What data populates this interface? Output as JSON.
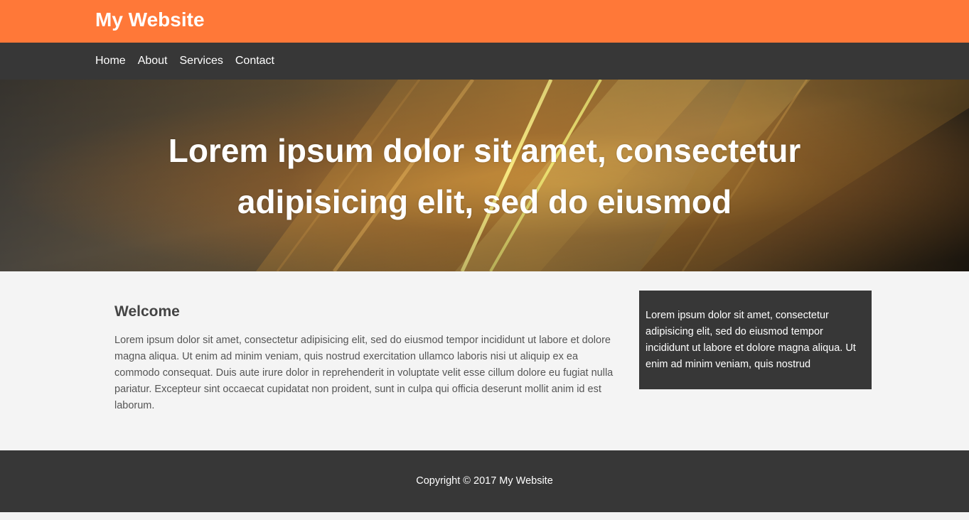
{
  "header": {
    "site_title": "My Website"
  },
  "nav": {
    "items": [
      {
        "label": "Home"
      },
      {
        "label": "About"
      },
      {
        "label": "Services"
      },
      {
        "label": "Contact"
      }
    ]
  },
  "hero": {
    "title": "Lorem ipsum dolor sit amet, consectetur adipisicing elit, sed do eiusmod"
  },
  "main": {
    "heading": "Welcome",
    "body": "Lorem ipsum dolor sit amet, consectetur adipisicing elit, sed do eiusmod tempor incididunt ut labore et dolore magna aliqua. Ut enim ad minim veniam, quis nostrud exercitation ullamco laboris nisi ut aliquip ex ea commodo consequat. Duis aute irure dolor in reprehenderit in voluptate velit esse cillum dolore eu fugiat nulla pariatur. Excepteur sint occaecat cupidatat non proident, sunt in culpa qui officia deserunt mollit anim id est laborum."
  },
  "sidebar": {
    "text": "Lorem ipsum dolor sit amet, consectetur adipisicing elit, sed do eiusmod tempor incididunt ut labore et dolore magna aliqua. Ut enim ad minim veniam, quis nostrud"
  },
  "footer": {
    "copyright": "Copyright © 2017 My Website"
  },
  "colors": {
    "header_bg": "#ff7838",
    "nav_bg": "#373737",
    "page_bg": "#f4f4f4",
    "footer_bg": "#373737",
    "sidebar_bg": "#373737"
  }
}
